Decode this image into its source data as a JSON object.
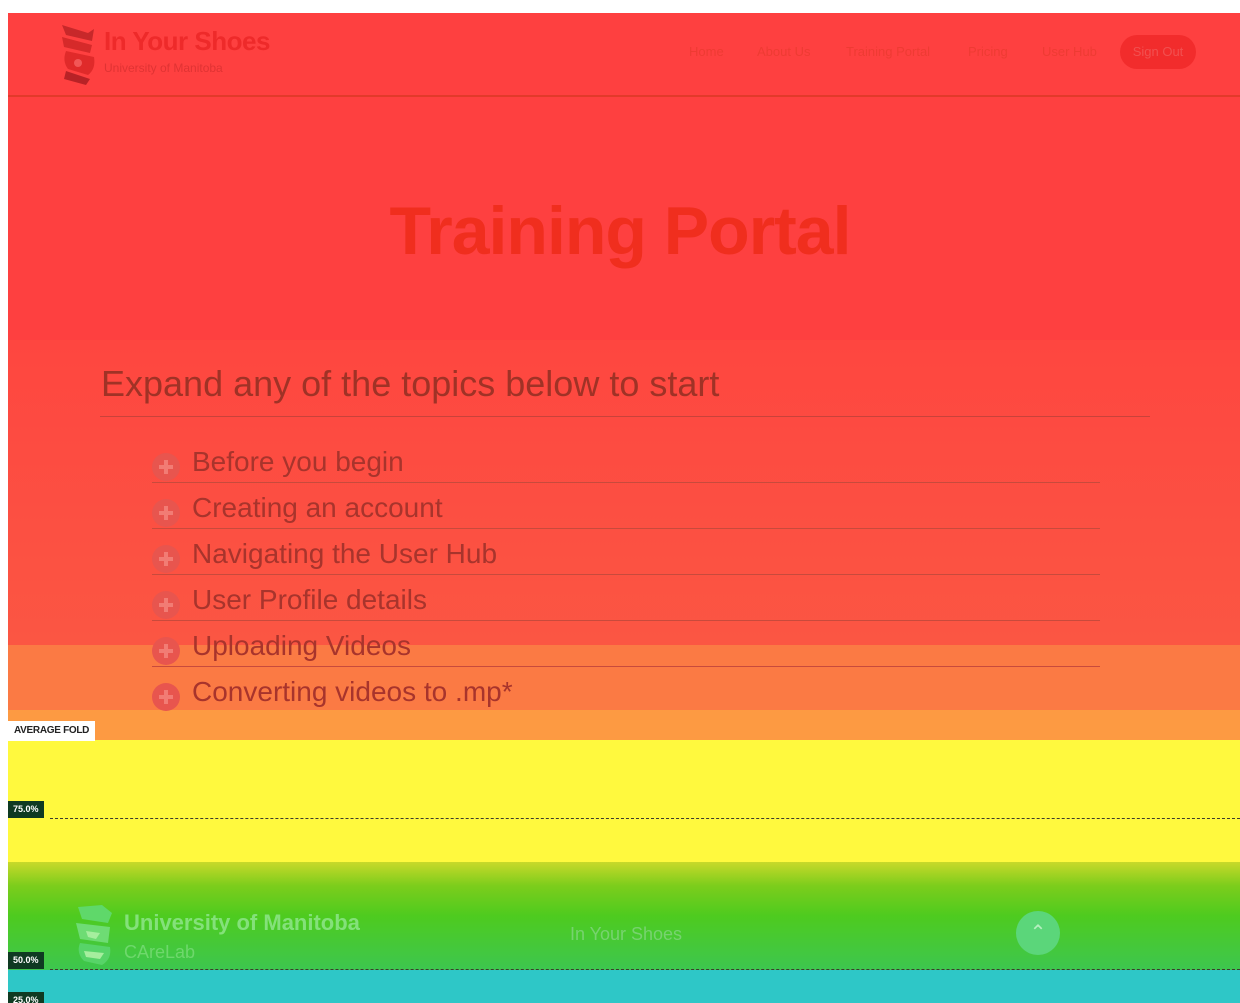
{
  "header": {
    "brand": "In Your Shoes",
    "sub": "University of Manitoba",
    "nav": [
      "Home",
      "About Us",
      "Training Portal",
      "Pricing",
      "User Hub"
    ],
    "sign_out": "Sign Out"
  },
  "main": {
    "title": "Training Portal",
    "heading": "Expand any of the topics below to start",
    "topics": [
      "Before you begin",
      "Creating an account",
      "Navigating the User Hub",
      "User Profile details",
      "Uploading Videos",
      "Converting videos to .mp*"
    ]
  },
  "heatmap": {
    "fold_label": "AVERAGE FOLD",
    "markers": [
      "75.0%",
      "50.0%",
      "25.0%"
    ],
    "colors": {
      "hot": "#fe4040",
      "warm": "#fb7a44",
      "medium": "#fff93e",
      "cool": "#4ecb1f",
      "cold": "#2ec7c7"
    }
  },
  "footer": {
    "uni_name": "University of Manitoba",
    "uni_sub": "CAreLab",
    "brand": "In Your Shoes",
    "scroll_icon": "chevron-up-icon"
  }
}
